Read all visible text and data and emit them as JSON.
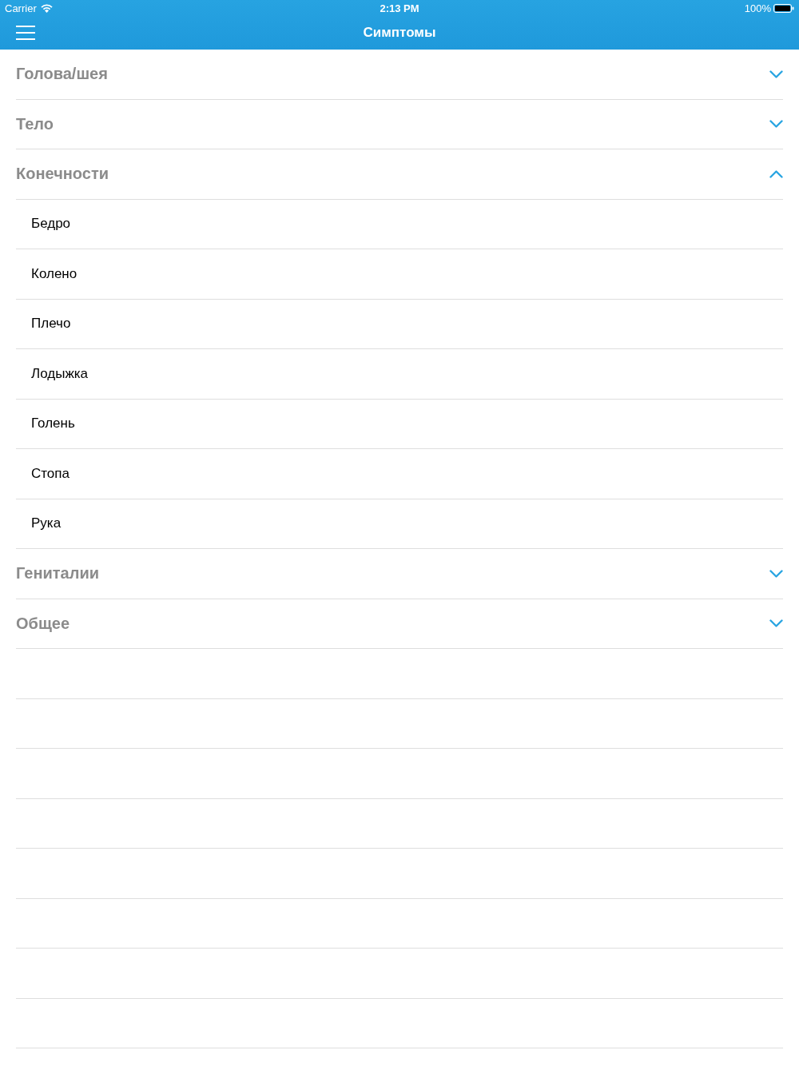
{
  "status_bar": {
    "carrier": "Carrier",
    "time": "2:13 PM",
    "battery": "100%"
  },
  "nav_bar": {
    "title": "Симптомы"
  },
  "sections": [
    {
      "title": "Голова/шея",
      "expanded": false
    },
    {
      "title": "Тело",
      "expanded": false
    },
    {
      "title": "Конечности",
      "expanded": true,
      "items": [
        "Бедро",
        "Колено",
        "Плечо",
        "Лодыжка",
        "Голень",
        "Стопа",
        "Рука"
      ]
    },
    {
      "title": "Гениталии",
      "expanded": false
    },
    {
      "title": "Общее",
      "expanded": false
    }
  ]
}
